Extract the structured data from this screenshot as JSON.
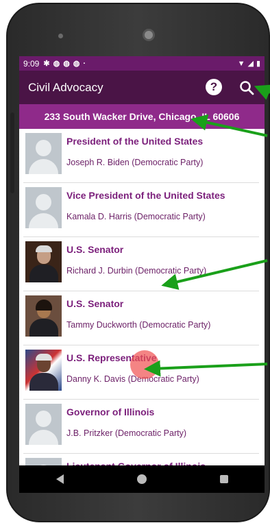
{
  "status_bar": {
    "time": "9:09",
    "icons": [
      "gear-icon",
      "notification-icon",
      "notification-icon",
      "notification-icon",
      "dot-icon"
    ],
    "right_icons": [
      "wifi-icon",
      "signal-icon",
      "battery-icon"
    ]
  },
  "app_bar": {
    "title": "Civil Advocacy",
    "help_label": "?",
    "search_icon": "search-icon"
  },
  "address": "233 South Wacker Drive, Chicago, IL 60606",
  "officials": [
    {
      "office": "President of the United States",
      "person": "Joseph R. Biden (Democratic Party)",
      "photo": "generic"
    },
    {
      "office": "Vice President of the United States",
      "person": "Kamala D. Harris (Democratic Party)",
      "photo": "generic"
    },
    {
      "office": "U.S. Senator",
      "person": "Richard J. Durbin (Democratic Party)",
      "photo": "p1"
    },
    {
      "office": "U.S. Senator",
      "person": "Tammy Duckworth (Democratic Party)",
      "photo": "p2"
    },
    {
      "office": "U.S. Representative",
      "person": "Danny K. Davis (Democratic Party)",
      "photo": "p3"
    },
    {
      "office": "Governor of Illinois",
      "person": "J.B. Pritzker (Democratic Party)",
      "photo": "generic"
    },
    {
      "office": "Lieutenant Governor of Illinois",
      "person": "",
      "photo": "generic"
    }
  ],
  "colors": {
    "status_bar": "#6a1b6a",
    "app_bar": "#4a1446",
    "address_bar": "#8f2a8a",
    "office_text": "#7b1f7b",
    "annotation_arrow": "#1aa01a"
  }
}
